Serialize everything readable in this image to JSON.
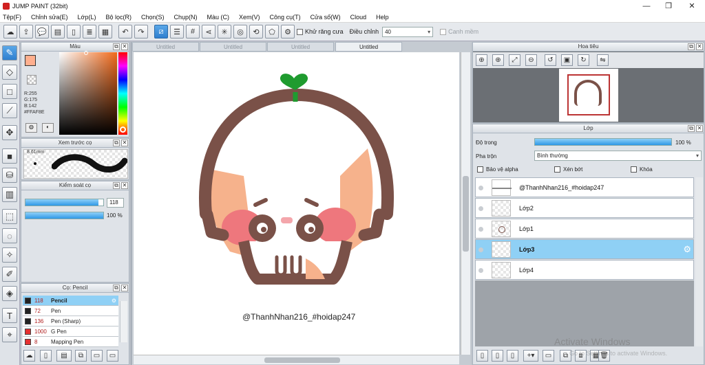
{
  "app": {
    "title": "JUMP PAINT (32bit)"
  },
  "window": {
    "minimize": "—",
    "restore": "❐",
    "close": "✕"
  },
  "menu": [
    "Tệp(F)",
    "Chỉnh sửa(E)",
    "Lớp(L)",
    "Bộ lọc(R)",
    "Chọn(S)",
    "Chụp(N)",
    "Màu (C)",
    "Xem(V)",
    "Công cụ(T)",
    "Cửa số(W)",
    "Cloud",
    "Help"
  ],
  "toolbar": {
    "antialias_label": "Khử răng cưa",
    "adjust_label": "Điều chỉnh",
    "adjust_value": "40",
    "margin_label": "Canh mềm"
  },
  "color_panel": {
    "title": "Màu",
    "r": "R:255",
    "g": "G:175",
    "b": "B:142",
    "hex": "#FFAF8E",
    "main_color": "#ffaf8e",
    "hue_color": "#f26a1b"
  },
  "preview_panel": {
    "title": "Xem trước cọ",
    "size": "8.61mm"
  },
  "control_panel": {
    "title": "Kiểm soát cọ",
    "size_value": "118",
    "size_fraction": 0.94,
    "opacity_value": "100 %",
    "opacity_fraction": 1.0
  },
  "brush_panel": {
    "title": "Cọ: Pencil",
    "brushes": [
      {
        "size": "118",
        "name": "Pencil",
        "color": "#222222"
      },
      {
        "size": "72",
        "name": "Pen",
        "color": "#222222"
      },
      {
        "size": "136",
        "name": "Pen (Sharp)",
        "color": "#222222"
      },
      {
        "size": "1000",
        "name": "G Pen",
        "color": "#e53030"
      },
      {
        "size": "8",
        "name": "Mapping Pen",
        "color": "#e53030"
      }
    ]
  },
  "canvas": {
    "tabs": [
      "Untitled",
      "Untitled",
      "Untitled",
      "Untitled"
    ],
    "watermark_text": "@ThanhNhan216_#hoidap247"
  },
  "navigator": {
    "title": "Hoa tiêu"
  },
  "layers_panel": {
    "title": "Lớp",
    "opacity_label": "Độ trong",
    "opacity_value": "100 %",
    "opacity_fraction": 1.0,
    "blend_label": "Pha trộn",
    "blend_value": "Bình thường",
    "protect_alpha": "Bảo vệ alpha",
    "clip": "Xén bớt",
    "lock": "Khóa",
    "layers": [
      {
        "name": "@ThanhNhan216_#hoidap247"
      },
      {
        "name": "Lớp2"
      },
      {
        "name": "Lớp1"
      },
      {
        "name": "Lớp3"
      },
      {
        "name": "Lớp4"
      }
    ]
  },
  "os_watermark": {
    "line1": "Activate Windows",
    "line2": "Go to Settings to activate Windows."
  }
}
